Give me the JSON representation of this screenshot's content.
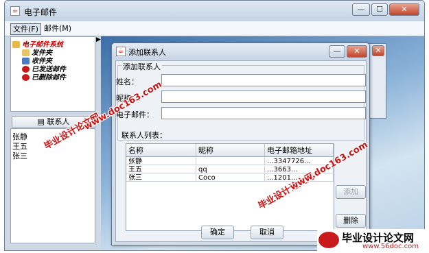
{
  "main_window": {
    "title": "电子邮件",
    "buttons": {
      "minimize": "—",
      "maximize": "☐",
      "close": "✕"
    }
  },
  "menubar": {
    "items": [
      {
        "label": "文件(F)"
      },
      {
        "label": "邮件(M)"
      }
    ]
  },
  "tree": {
    "root": "电子邮件系统",
    "items": [
      {
        "label": "发件夹",
        "icon": "outbox-icon"
      },
      {
        "label": "收件夹",
        "icon": "inbox-icon"
      },
      {
        "label": "已发送邮件",
        "icon": "sent-icon"
      },
      {
        "label": "已删除邮件",
        "icon": "deleted-icon"
      }
    ]
  },
  "contacts": {
    "button_label": "联系人",
    "list": [
      "张静",
      "王五",
      "张三"
    ]
  },
  "dialog": {
    "title": "添加联系人",
    "group_title": "添加联系人",
    "fields": {
      "name_label": "姓名：",
      "nickname_label": "昵称：",
      "email_label": "电子邮件："
    },
    "list_title": "联系人列表：",
    "table": {
      "headers": [
        "名称",
        "昵称",
        "电子邮箱地址"
      ],
      "rows": [
        [
          "张静",
          "",
          "...3347726..."
        ],
        [
          "王五",
          "qq",
          "...3663..."
        ],
        [
          "张三",
          "Coco",
          "...1201..."
        ]
      ]
    },
    "add_label": "添加",
    "delete_label": "删除",
    "ok_label": "确定",
    "cancel_label": "取消"
  },
  "watermark": {
    "text_main": "毕业设计论文网",
    "url": "www.doc163.com",
    "logo_text": "毕业设计论文网",
    "logo_url": "www.56doc.com"
  },
  "colors": {
    "watermark": "#d01010",
    "desktop": "#3b6ea8",
    "title_bar": "#c7d5e6"
  }
}
